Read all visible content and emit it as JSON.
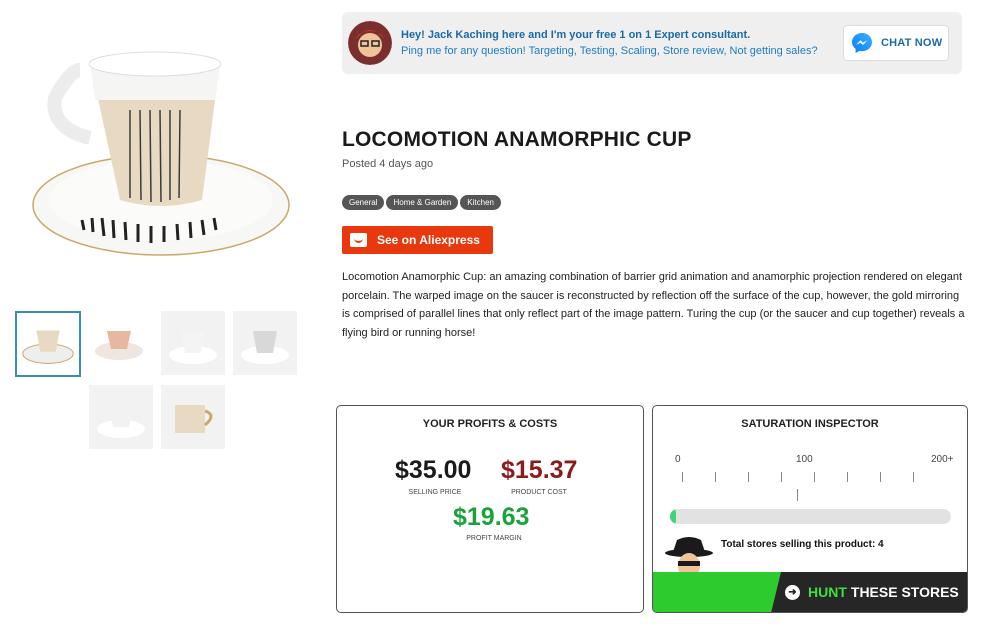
{
  "banner": {
    "line1": "Hey! Jack Kaching here and I'm your free 1 on 1 Expert consultant.",
    "line2": "Ping me for any question! Targeting, Testing, Scaling, Store review, Not getting sales?",
    "chat_label": "CHAT NOW",
    "chat_icon": "messenger-icon"
  },
  "product": {
    "title": "LOCOMOTION ANAMORPHIC CUP",
    "posted": "Posted 4 days ago",
    "tags": [
      "General",
      "Home & Garden",
      "Kitchen"
    ],
    "aliexpress_label": "See on Aliexpress",
    "description": "Locomotion Anamorphic Cup: an amazing combination of barrier grid animation and anamorphic projection rendered on elegant porcelain. The warped image on the saucer is reconstructed by reflection off the surface of the cup, however, the gold mirroring is comprised of parallel lines that only reflect part of the image pattern. Turing the cup (or the saucer and cup together) reveals a flying bird or running horse!"
  },
  "gallery": {
    "thumbnail_count": 6,
    "active_index": 0
  },
  "profits": {
    "title": "YOUR PROFITS & COSTS",
    "selling_price": "$35.00",
    "selling_label": "SELLING PRICE",
    "product_cost": "$15.37",
    "cost_label": "PRODUCT COST",
    "profit_margin": "$19.63",
    "margin_label": "PROFIT MARGIN",
    "colors": {
      "price": "#1a1a1a",
      "cost": "#8b1a1a",
      "margin": "#1aa33a"
    }
  },
  "saturation": {
    "title": "SATURATION INSPECTOR",
    "scale_min": "0",
    "scale_mid": "100",
    "scale_max": "200+",
    "level_fraction": 0.02,
    "stores_text": "Total stores selling this product: 4",
    "hunt_word1": "HUNT",
    "hunt_word2": "THESE STORES"
  }
}
